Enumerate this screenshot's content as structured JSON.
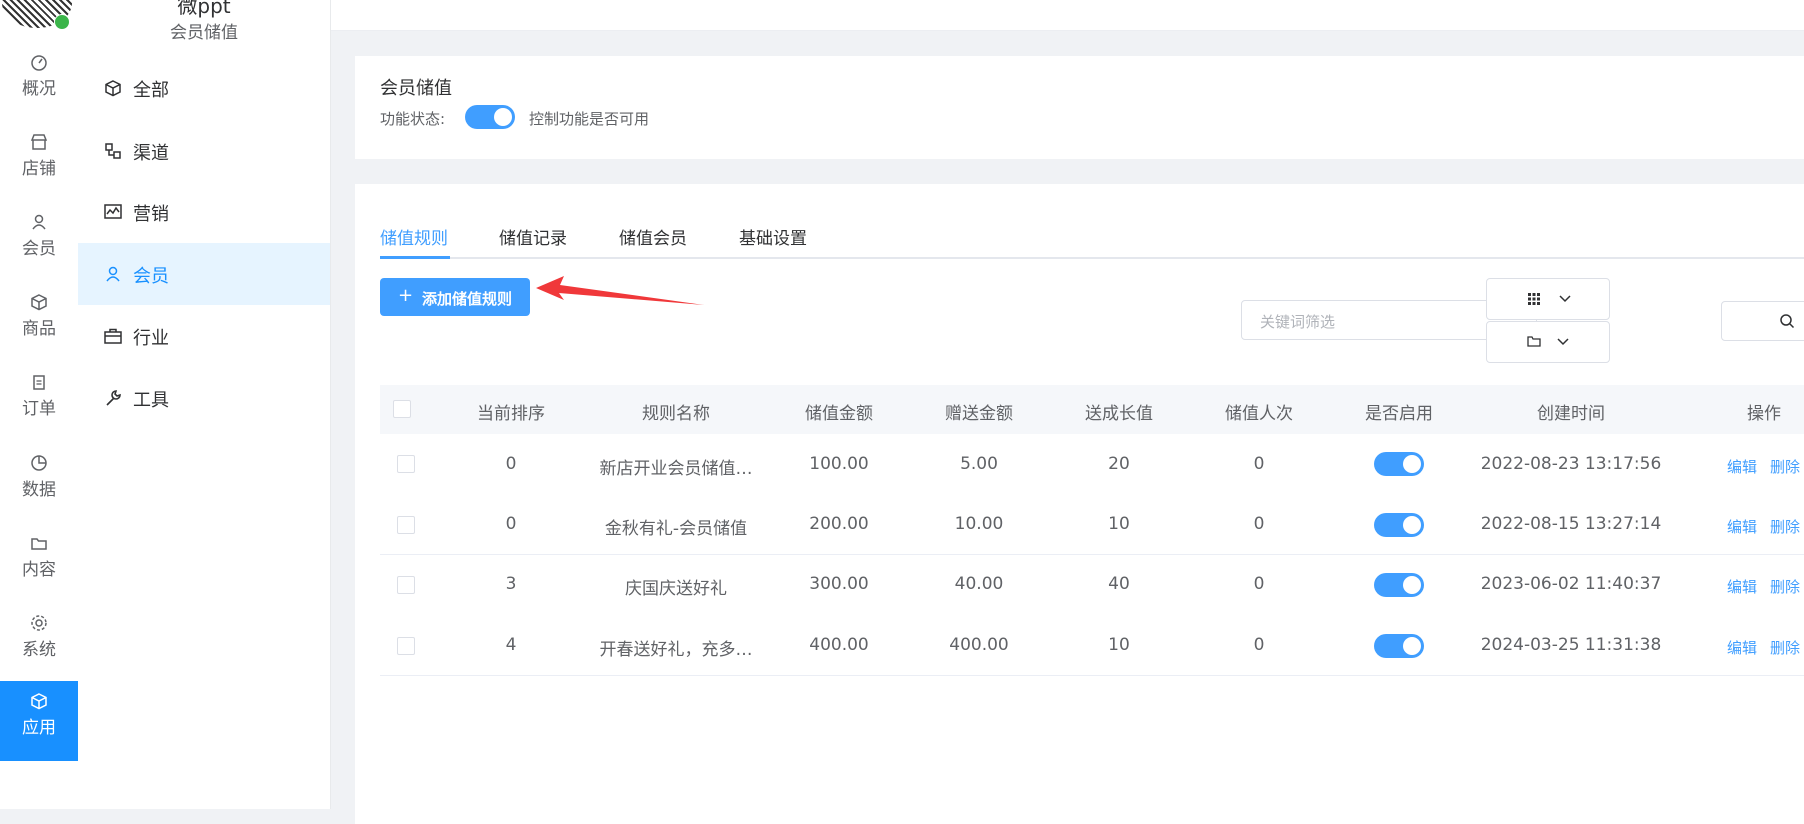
{
  "rail": {
    "items": [
      {
        "label": "概况",
        "icon": "dashboard-icon"
      },
      {
        "label": "店铺",
        "icon": "store-icon"
      },
      {
        "label": "会员",
        "icon": "user-icon"
      },
      {
        "label": "商品",
        "icon": "box-icon"
      },
      {
        "label": "订单",
        "icon": "clipboard-icon"
      },
      {
        "label": "数据",
        "icon": "pie-icon"
      },
      {
        "label": "内容",
        "icon": "folder-icon"
      },
      {
        "label": "系统",
        "icon": "gear-icon"
      },
      {
        "label": "应用",
        "icon": "cube-icon",
        "active": true
      }
    ]
  },
  "shop": {
    "name": "微ppt",
    "subtitle": "会员储值"
  },
  "sidebar": {
    "items": [
      {
        "label": "全部",
        "icon": "cube-icon"
      },
      {
        "label": "渠道",
        "icon": "channel-icon"
      },
      {
        "label": "营销",
        "icon": "chart-icon"
      },
      {
        "label": "会员",
        "icon": "user-icon",
        "active": true
      },
      {
        "label": "行业",
        "icon": "briefcase-icon"
      },
      {
        "label": "工具",
        "icon": "wrench-icon"
      }
    ]
  },
  "feature": {
    "title": "会员储值",
    "status_label": "功能状态:",
    "enabled": true,
    "status_tip": "控制功能是否可用"
  },
  "tabs": [
    "储值规则",
    "储值记录",
    "储值会员",
    "基础设置"
  ],
  "toolbar": {
    "add_label": "添加储值规则",
    "keyword_placeholder": "关键词筛选"
  },
  "table": {
    "headers": [
      "当前排序",
      "规则名称",
      "储值金额",
      "赠送金额",
      "送成长值",
      "储值人次",
      "是否启用",
      "创建时间",
      "操作"
    ],
    "rows": [
      {
        "order": "0",
        "name": "新店开业会员储值…",
        "amount": "100.00",
        "gift": "5.00",
        "growth": "20",
        "count": "0",
        "enabled": true,
        "created": "2022-08-23 13:17:56"
      },
      {
        "order": "0",
        "name": "金秋有礼-会员储值",
        "amount": "200.00",
        "gift": "10.00",
        "growth": "10",
        "count": "0",
        "enabled": true,
        "created": "2022-08-15 13:27:14"
      },
      {
        "order": "3",
        "name": "庆国庆送好礼",
        "amount": "300.00",
        "gift": "40.00",
        "growth": "40",
        "count": "0",
        "enabled": true,
        "created": "2023-06-02 11:40:37"
      },
      {
        "order": "4",
        "name": "开春送好礼，充多…",
        "amount": "400.00",
        "gift": "400.00",
        "growth": "10",
        "count": "0",
        "enabled": true,
        "created": "2024-03-25 11:31:38"
      }
    ],
    "edit_label": "编辑",
    "delete_label": "删除"
  },
  "colors": {
    "primary": "#409eff",
    "rail_active": "#1890ff",
    "arrow": "#f0383a"
  }
}
